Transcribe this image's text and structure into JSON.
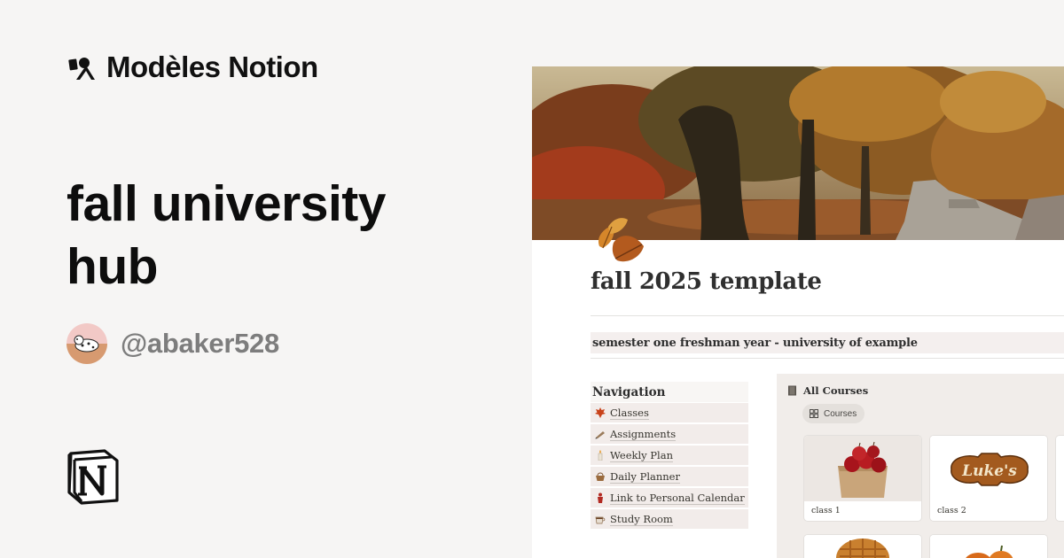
{
  "brand": {
    "name": "Modèles Notion",
    "logo_icon": "shapes-logo-icon"
  },
  "headline": "fall university hub",
  "author": {
    "handle": "@abaker528",
    "avatar_icon": "dalmatian-avatar"
  },
  "footer_logo": "notion-logo-icon",
  "preview": {
    "cover_image": "autumn-park-path",
    "page_icon": "autumn-leaves-icon",
    "title": "fall 2025 template",
    "subtitle": "semester one freshman year - university of example",
    "navigation": {
      "heading": "Navigation",
      "items": [
        {
          "label": "Classes",
          "icon": "maple-leaf-icon"
        },
        {
          "label": "Assignments",
          "icon": "pencil-icon"
        },
        {
          "label": "Weekly Plan",
          "icon": "candle-icon"
        },
        {
          "label": "Daily Planner",
          "icon": "basket-icon"
        },
        {
          "label": "Link to Personal Calendar",
          "icon": "red-figure-icon"
        },
        {
          "label": "Study Room",
          "icon": "coffee-icon"
        }
      ]
    },
    "courses": {
      "heading": "All Courses",
      "heading_icon": "book-icon",
      "view_label": "Courses",
      "view_icon": "gallery-icon",
      "cards": [
        {
          "caption": "class 1",
          "image": "apples-in-bag"
        },
        {
          "caption": "class 2",
          "image": "lukes-diner-sign"
        }
      ],
      "second_row_images": [
        "pie",
        "pumpkins"
      ]
    }
  },
  "colors": {
    "background": "#f6f5f4",
    "panel": "#f1edea",
    "accent": "#c0561e"
  }
}
